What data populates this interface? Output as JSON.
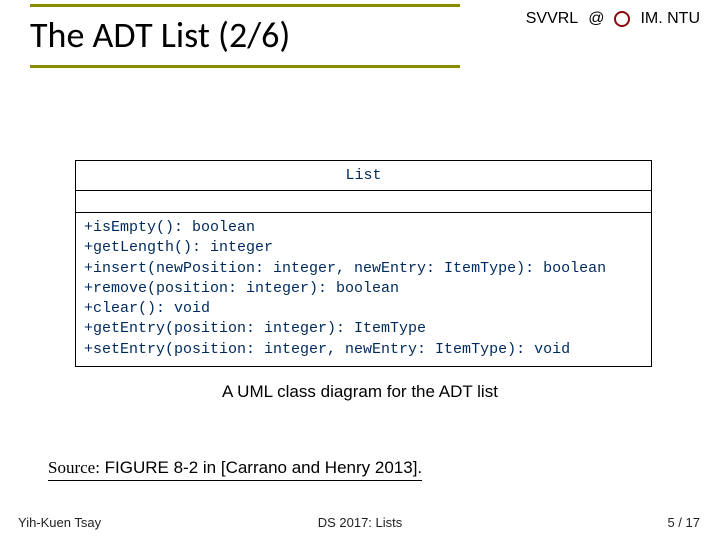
{
  "header": {
    "left_label": "SVVRL",
    "right_label": "IM. NTU"
  },
  "title": "The ADT List (2/6)",
  "uml": {
    "class_name": "List",
    "operations": [
      "+isEmpty(): boolean",
      "+getLength(): integer",
      "+insert(newPosition: integer, newEntry: ItemType): boolean",
      "+remove(position: integer): boolean",
      "+clear(): void",
      "+getEntry(position: integer): ItemType",
      "+setEntry(position: integer, newEntry: ItemType): void"
    ]
  },
  "caption": "A UML class diagram for the ADT list",
  "source": {
    "label": "Source:",
    "text": " FIGURE 8-2 in [Carrano and Henry 2013]."
  },
  "footer": {
    "author": "Yih-Kuen Tsay",
    "course": "DS 2017: Lists",
    "page": "5 / 17"
  }
}
